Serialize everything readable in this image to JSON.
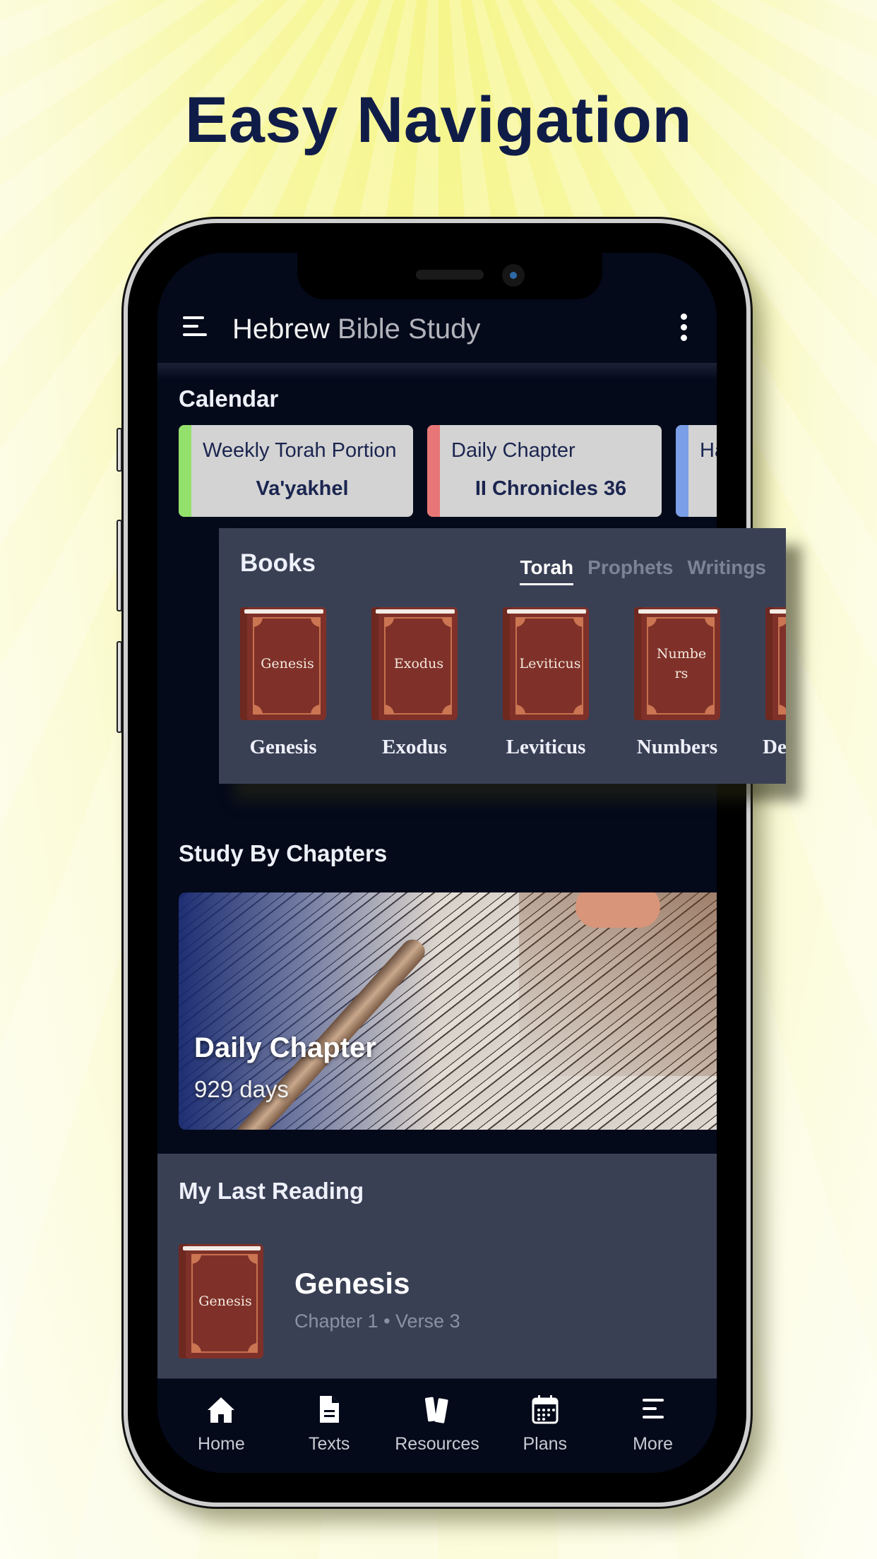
{
  "headline": "Easy Navigation",
  "app": {
    "title_part1": "Hebrew",
    "title_part2": "Bible Study"
  },
  "calendar": {
    "title": "Calendar",
    "cards": [
      {
        "label": "Weekly Torah Portion",
        "value": "Va'yakhel",
        "accent": "#93e06c"
      },
      {
        "label": "Daily Chapter",
        "value": "II Chronicles 36",
        "accent": "#e87676"
      },
      {
        "label": "Ha",
        "value": "",
        "accent": "#7a9ee8"
      }
    ]
  },
  "books": {
    "title": "Books",
    "tabs": [
      {
        "label": "Torah",
        "active": true
      },
      {
        "label": "Prophets",
        "active": false
      },
      {
        "label": "Writings",
        "active": false
      }
    ],
    "items": [
      {
        "cover": "Genesis",
        "name": "Genesis"
      },
      {
        "cover": "Exodus",
        "name": "Exodus"
      },
      {
        "cover": "Leviticus",
        "name": "Leviticus"
      },
      {
        "cover": "Numbers",
        "name": "Numbers"
      },
      {
        "cover": "",
        "name": "Deu"
      }
    ]
  },
  "study": {
    "title": "Study By Chapters",
    "card_title": "Daily Chapter",
    "card_subtitle": "929 days"
  },
  "last_reading": {
    "title": "My Last Reading",
    "book_cover": "Genesis",
    "book_name": "Genesis",
    "meta": "Chapter 1 • Verse 3"
  },
  "nav": [
    {
      "label": "Home",
      "icon": "home-icon"
    },
    {
      "label": "Texts",
      "icon": "document-icon"
    },
    {
      "label": "Resources",
      "icon": "books-icon"
    },
    {
      "label": "Plans",
      "icon": "calendar-icon"
    },
    {
      "label": "More",
      "icon": "menu-icon"
    }
  ]
}
